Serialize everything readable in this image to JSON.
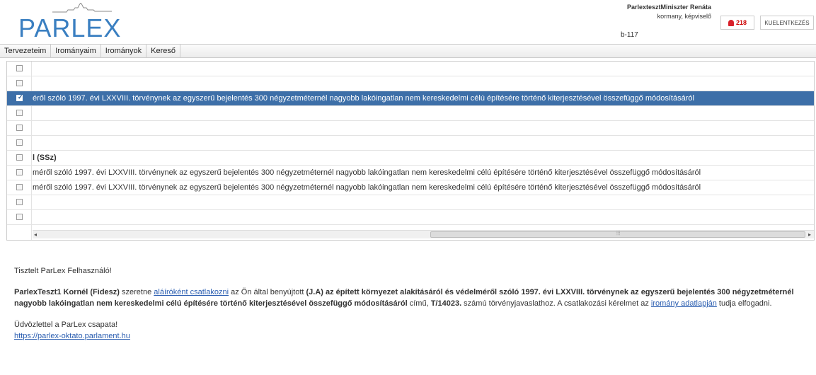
{
  "header": {
    "logo_text": "PARLEX",
    "user_name": "ParlextesztMiniszter Renáta",
    "user_role": "kormany, képviselő",
    "room": "b-117",
    "notifications": "218",
    "logout": "KUELENTKEZÉS"
  },
  "menu": [
    "Tervezeteim",
    "Irományaim",
    "Irományok",
    "Kereső"
  ],
  "grid": {
    "rows": [
      {
        "text": "",
        "checked": false,
        "selected": false,
        "bold": false
      },
      {
        "text": "",
        "checked": false,
        "selected": false,
        "bold": false
      },
      {
        "text": "éről szóló 1997. évi LXXVIII. törvénynek az egyszerű bejelentés 300 négyzetméternél nagyobb lakóingatlan nem kereskedelmi célú építésére történő kiterjesztésével összefüggő módosításáról",
        "checked": true,
        "selected": true,
        "bold": false
      },
      {
        "text": "",
        "checked": false,
        "selected": false,
        "bold": false
      },
      {
        "text": "",
        "checked": false,
        "selected": false,
        "bold": false
      },
      {
        "text": "",
        "checked": false,
        "selected": false,
        "bold": false
      },
      {
        "text": "l (SSz)",
        "checked": false,
        "selected": false,
        "bold": true
      },
      {
        "text": "méről szóló 1997. évi LXXVIII. törvénynek az egyszerű bejelentés 300 négyzetméternél nagyobb lakóingatlan nem kereskedelmi célú építésére történő kiterjesztésével összefüggő módosításáról",
        "checked": false,
        "selected": false,
        "bold": false
      },
      {
        "text": "méről szóló 1997. évi LXXVIII. törvénynek az egyszerű bejelentés 300 négyzetméternél nagyobb lakóingatlan nem kereskedelmi célú építésére történő kiterjesztésével összefüggő módosításáról",
        "checked": false,
        "selected": false,
        "bold": false
      },
      {
        "text": "",
        "checked": false,
        "selected": false,
        "bold": false
      },
      {
        "text": "",
        "checked": false,
        "selected": false,
        "bold": false
      }
    ]
  },
  "message": {
    "greeting": "Tisztelt ParLex Felhasználó!",
    "sender": "ParlexTeszt1 Kornél (Fidesz)",
    "t1": " szeretne ",
    "link1": "aláíróként csatlakozni",
    "t2": " az Ön által benyújtott ",
    "bill_title": "(J.A) az épített környezet alakításáról és védelméről szóló 1997. évi LXXVIII. törvénynek az egyszerű bejelentés 300 négyzetméternél nagyobb lakóingatlan nem kereskedelmi célú építésére történő kiterjesztésével összefüggő módosításáról",
    "t3": " című, ",
    "bill_number": "T/14023.",
    "t4": " számú törvényjavaslathoz. A csatlakozási kérelmet az ",
    "link2": "iromány adatlapján",
    "t5": " tudja elfogadni.",
    "closing": "Üdvözlettel a ParLex csapata!",
    "url": "https://parlex-oktato.parlament.hu"
  }
}
